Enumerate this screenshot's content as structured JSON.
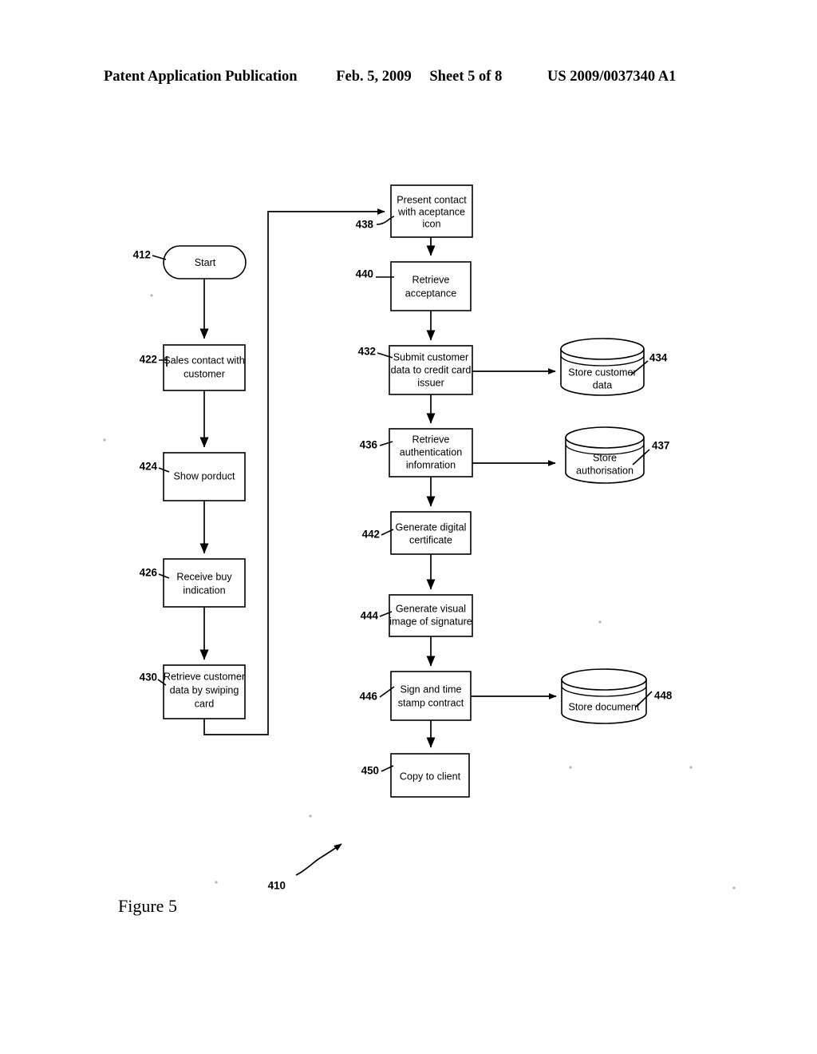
{
  "header": {
    "publication": "Patent Application Publication",
    "date": "Feb. 5, 2009",
    "sheet": "Sheet 5 of 8",
    "patent_number": "US 2009/0037340 A1"
  },
  "figure": {
    "caption": "Figure 5",
    "diagram_ref": "410"
  },
  "colors": {
    "ink": "#000000",
    "page": "#ffffff"
  },
  "chart_data": {
    "type": "diagram",
    "title": "Figure 5",
    "diagram_kind": "flowchart"
  },
  "nodes": {
    "start": {
      "ref": "412",
      "shape": "oval",
      "lines": [
        "Start"
      ]
    },
    "sales_contact": {
      "ref": "422",
      "shape": "rect",
      "lines": [
        "Sales contact with",
        "customer"
      ]
    },
    "show_product": {
      "ref": "424",
      "shape": "rect",
      "lines": [
        "Show porduct"
      ]
    },
    "receive_buy": {
      "ref": "426",
      "shape": "rect",
      "lines": [
        "Receive buy",
        "indication"
      ]
    },
    "retrieve_customer_data": {
      "ref": "430",
      "shape": "rect",
      "lines": [
        "Retrieve customer",
        "data by swiping",
        "card"
      ]
    },
    "present_contact": {
      "ref": "438",
      "shape": "rect",
      "lines": [
        "Present contact",
        "with aceptance",
        "icon"
      ]
    },
    "retrieve_acceptance": {
      "ref": "440",
      "shape": "rect",
      "lines": [
        "Retrieve",
        "acceptance"
      ]
    },
    "submit_customer_data": {
      "ref": "432",
      "shape": "rect",
      "lines": [
        "Submit customer",
        "data to credit card",
        "issuer"
      ]
    },
    "store_customer_data": {
      "ref": "434",
      "shape": "cylinder",
      "lines": [
        "Store customer",
        "data"
      ]
    },
    "retrieve_authentication": {
      "ref": "436",
      "shape": "rect",
      "lines": [
        "Retrieve",
        "authentication",
        "infomration"
      ]
    },
    "store_authorisation": {
      "ref": "437",
      "shape": "cylinder",
      "lines": [
        "Store",
        "authorisation"
      ]
    },
    "generate_certificate": {
      "ref": "442",
      "shape": "rect",
      "lines": [
        "Generate digital",
        "certificate"
      ]
    },
    "generate_visual_image": {
      "ref": "444",
      "shape": "rect",
      "lines": [
        "Generate visual",
        "image of signature"
      ]
    },
    "sign_timestamp": {
      "ref": "446",
      "shape": "rect",
      "lines": [
        "Sign and time",
        "stamp contract"
      ]
    },
    "store_document": {
      "ref": "448",
      "shape": "cylinder",
      "lines": [
        "Store document"
      ]
    },
    "copy_to_client": {
      "ref": "450",
      "shape": "rect",
      "lines": [
        "Copy to client"
      ]
    }
  }
}
